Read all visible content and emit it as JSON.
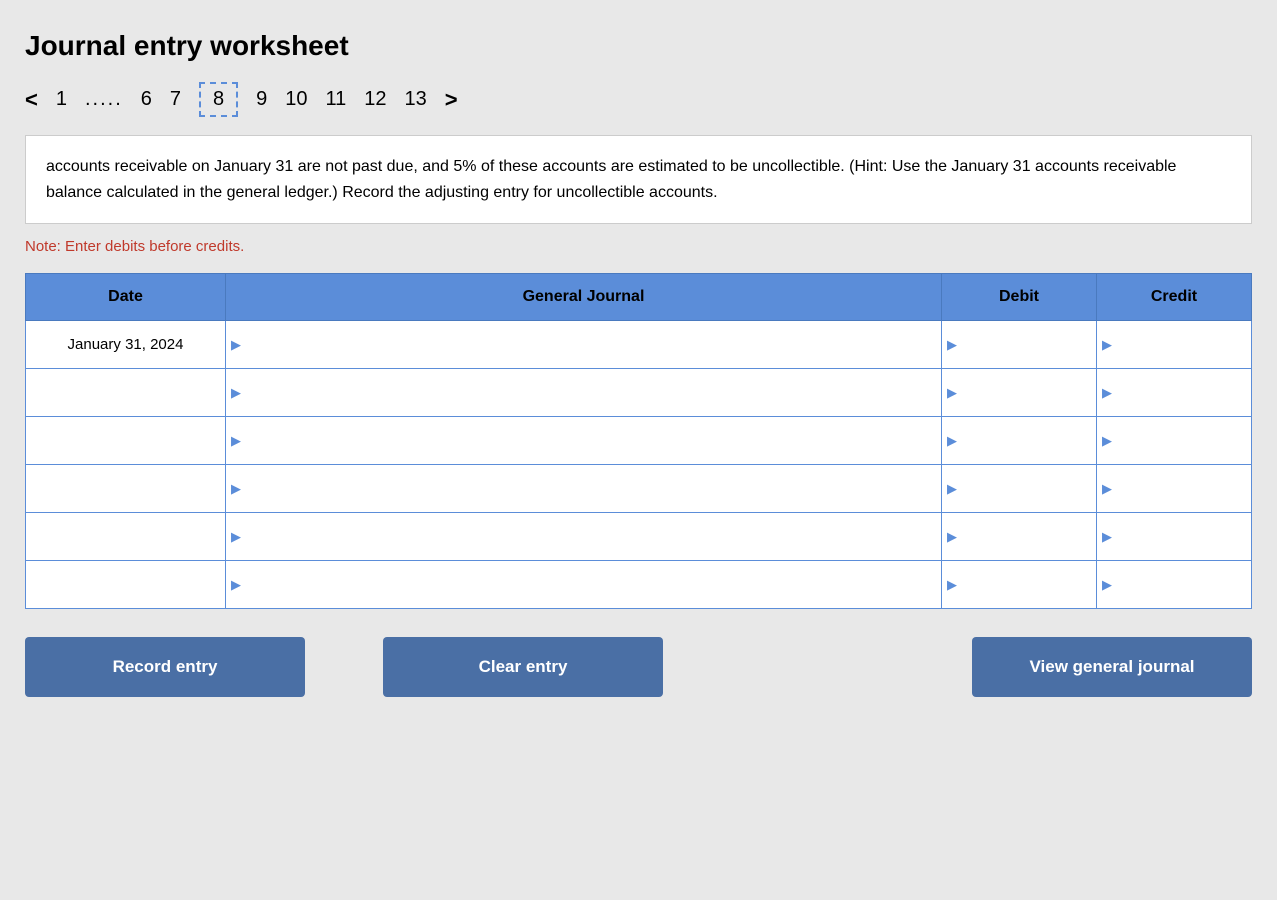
{
  "title": "Journal entry worksheet",
  "pagination": {
    "prev_arrow": "<",
    "next_arrow": ">",
    "items": [
      "1",
      ".....",
      "6",
      "7",
      "8",
      "9",
      "10",
      "11",
      "12",
      "13"
    ],
    "active": "8"
  },
  "description": "accounts receivable on January 31 are not past due, and 5% of these accounts are estimated to be uncollectible. (Hint: Use the January 31 accounts receivable balance calculated in the general ledger.) Record the adjusting entry for uncollectible accounts.",
  "note": "Note: Enter debits before credits.",
  "table": {
    "headers": {
      "date": "Date",
      "journal": "General Journal",
      "debit": "Debit",
      "credit": "Credit"
    },
    "rows": [
      {
        "date": "January 31, 2024",
        "journal": "",
        "debit": "",
        "credit": ""
      },
      {
        "date": "",
        "journal": "",
        "debit": "",
        "credit": ""
      },
      {
        "date": "",
        "journal": "",
        "debit": "",
        "credit": ""
      },
      {
        "date": "",
        "journal": "",
        "debit": "",
        "credit": ""
      },
      {
        "date": "",
        "journal": "",
        "debit": "",
        "credit": ""
      },
      {
        "date": "",
        "journal": "",
        "debit": "",
        "credit": ""
      }
    ]
  },
  "buttons": {
    "record": "Record entry",
    "clear": "Clear entry",
    "view": "View general journal"
  }
}
